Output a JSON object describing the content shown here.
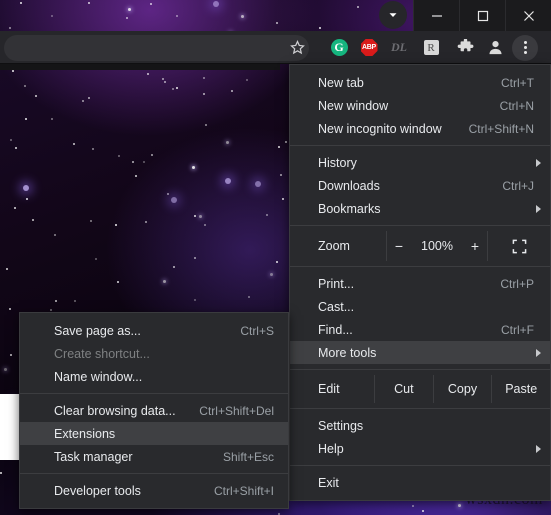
{
  "window": {
    "controls": [
      {
        "name": "minimize",
        "glyph": "minimize-icon"
      },
      {
        "name": "maximize",
        "glyph": "maximize-icon"
      },
      {
        "name": "close",
        "glyph": "close-icon"
      }
    ],
    "tab_search_icon": "tab-search-chevron-icon"
  },
  "toolbar": {
    "omnibox_value": "",
    "omnibox_placeholder": "",
    "icons": [
      {
        "name": "bookmark-star-icon",
        "label": ""
      },
      {
        "name": "grammarly-extension-icon",
        "label": "G"
      },
      {
        "name": "adblock-plus-extension-icon",
        "label": "ABP"
      },
      {
        "name": "downloader-extension-icon",
        "label": "DL"
      },
      {
        "name": "rakuten-extension-icon",
        "label": "R"
      },
      {
        "name": "extensions-puzzle-icon",
        "label": ""
      },
      {
        "name": "profile-avatar-icon",
        "label": ""
      },
      {
        "name": "chrome-three-dot-menu-icon",
        "label": ""
      }
    ]
  },
  "menu": {
    "items": [
      {
        "label": "New tab",
        "accel": "Ctrl+T",
        "arrow": false,
        "highlighted": false
      },
      {
        "label": "New window",
        "accel": "Ctrl+N",
        "arrow": false,
        "highlighted": false
      },
      {
        "label": "New incognito window",
        "accel": "Ctrl+Shift+N",
        "arrow": false,
        "highlighted": false
      }
    ],
    "nav_items": [
      {
        "label": "History",
        "accel": "",
        "arrow": true,
        "highlighted": false
      },
      {
        "label": "Downloads",
        "accel": "Ctrl+J",
        "arrow": false,
        "highlighted": false
      },
      {
        "label": "Bookmarks",
        "accel": "",
        "arrow": true,
        "highlighted": false
      }
    ],
    "zoom": {
      "label": "Zoom",
      "minus": "−",
      "value": "100%",
      "plus": "+",
      "fullscreen_icon": "fullscreen-icon"
    },
    "print_items": [
      {
        "label": "Print...",
        "accel": "Ctrl+P",
        "arrow": false,
        "highlighted": false
      },
      {
        "label": "Cast...",
        "accel": "",
        "arrow": false,
        "highlighted": false
      },
      {
        "label": "Find...",
        "accel": "Ctrl+F",
        "arrow": false,
        "highlighted": false
      },
      {
        "label": "More tools",
        "accel": "",
        "arrow": true,
        "highlighted": true
      }
    ],
    "edit_row": {
      "label": "Edit",
      "buttons": [
        "Cut",
        "Copy",
        "Paste"
      ]
    },
    "settings_items": [
      {
        "label": "Settings",
        "accel": "",
        "arrow": false,
        "highlighted": false
      },
      {
        "label": "Help",
        "accel": "",
        "arrow": true,
        "highlighted": false
      }
    ],
    "exit_items": [
      {
        "label": "Exit",
        "accel": "",
        "arrow": false,
        "highlighted": false
      }
    ]
  },
  "submenu": {
    "group1": [
      {
        "label": "Save page as...",
        "accel": "Ctrl+S",
        "disabled": false,
        "highlighted": false
      },
      {
        "label": "Create shortcut...",
        "accel": "",
        "disabled": true,
        "highlighted": false
      },
      {
        "label": "Name window...",
        "accel": "",
        "disabled": false,
        "highlighted": false
      }
    ],
    "group2": [
      {
        "label": "Clear browsing data...",
        "accel": "Ctrl+Shift+Del",
        "disabled": false,
        "highlighted": false
      },
      {
        "label": "Extensions",
        "accel": "",
        "disabled": false,
        "highlighted": true
      },
      {
        "label": "Task manager",
        "accel": "Shift+Esc",
        "disabled": false,
        "highlighted": false
      }
    ],
    "group3": [
      {
        "label": "Developer tools",
        "accel": "Ctrl+Shift+I",
        "disabled": false,
        "highlighted": false
      }
    ]
  },
  "watermark": {
    "text": "wsxdn.com"
  },
  "colors": {
    "menu_bg": "#292a2d",
    "menu_highlight": "#3f4043",
    "menu_text": "#e8eaed",
    "accel_text": "#9aa0a6",
    "toolbar_bg": "#26262a",
    "omnibox_bg": "#323236"
  }
}
